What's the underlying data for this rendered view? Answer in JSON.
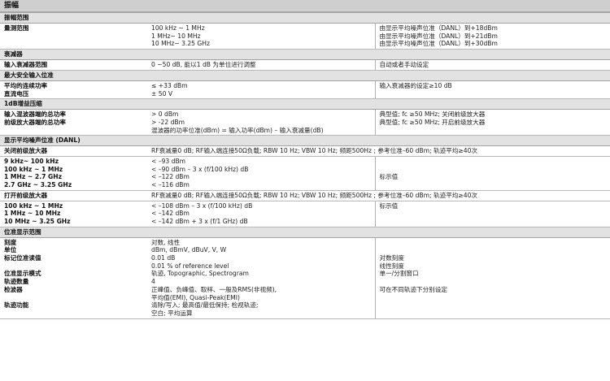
{
  "title": "振幅",
  "sections": {
    "s1": {
      "header": "振幅范围"
    },
    "s2": {
      "header": "衰减器"
    },
    "s3": {
      "header": "最大安全输入位准"
    },
    "s4": {
      "header": "1dB增益压缩"
    },
    "s5": {
      "header": "显示平均噪声位准 (DANL)"
    },
    "s6": {
      "header": "位准显示范围"
    }
  },
  "rows": {
    "r1": {
      "label": [
        "量测范围"
      ],
      "value": [
        "100 kHz ~ 1 MHz",
        "1 MHz~ 10 MHz",
        "10 MHz~ 3.25 GHz"
      ],
      "note": [
        "由显示平均噪声位准（DANL）到+18dBm",
        "由显示平均噪声位准（DANL）到+21dBm",
        "由显示平均噪声位准（DANL）到+30dBm"
      ]
    },
    "r2": {
      "label": [
        "输入衰减器范围"
      ],
      "value": [
        "0 ~50 dB, 能以1 dB 为单位进行调整"
      ],
      "note": [
        "自动或者手动设定"
      ]
    },
    "r3": {
      "label": [
        "平均的连续功率",
        "直流电压"
      ],
      "value": [
        "≤ +33 dBm",
        "± 50 V"
      ],
      "note": [
        "输入衰减器的设定≥10 dB"
      ]
    },
    "r4": {
      "label": [
        "输入混波器端的总功率",
        "前级放大器端的总功率"
      ],
      "value": [
        "> 0 dBm",
        "> -22 dBm",
        "混波器的功率位准(dBm) = 输入功率(dBm) – 输入衰减量(dB)"
      ],
      "note": [
        "典型值; fc ≥50 MHz; 关闭前级放大器",
        "典型值; fc ≥50 MHz; 开启前级放大器"
      ]
    },
    "r5": {
      "label": [
        "关闭前级放大器"
      ],
      "span": "RF衰减量0 dB; RF输入端连接50Ω负载; RBW 10 Hz; VBW 10 Hz; 频距500Hz ; 参考位准–60 dBm; 轨迹平均≥40次"
    },
    "r6": {
      "label": [
        "9 kHz~ 100 kHz",
        "100 kHz ~ 1 MHz",
        "1 MHz ~ 2.7 GHz",
        "2.7 GHz ~ 3.25 GHz"
      ],
      "value": [
        "< –93 dBm",
        "< –90 dBm – 3 x (f/100 kHz) dB",
        "< –122 dBm",
        "< –116 dBm"
      ],
      "note": [
        "",
        "",
        "标示值"
      ]
    },
    "r7": {
      "label": [
        "打开前级放大器"
      ],
      "span": "RF衰减量0 dB; RF输入端连接50Ω负载; RBW 10 Hz; VBW 10 Hz; 频距500Hz ; 参考位准–60 dBm; 轨迹平均≥40次"
    },
    "r8": {
      "label": [
        "100 kHz ~ 1 MHz",
        "1 MHz ~ 10 MHz",
        "10 MHz ~ 3.25 GHz"
      ],
      "value": [
        "< –108 dBm – 3 x (f/100 kHz) dB",
        "< –142 dBm",
        "< –142 dBm + 3 x (f/1 GHz) dB"
      ],
      "note": [
        "标示值"
      ]
    },
    "r9": {
      "label": [
        "刻度",
        "单位",
        "标记位准读值",
        "",
        "位准显示模式",
        "轨迹数量",
        "检波器",
        "",
        "轨迹功能",
        ""
      ],
      "value": [
        "对数, 线性",
        "dBm, dBmV, dBuV, V, W",
        "0.01 dB",
        "0.01 % of reference level",
        "轨迹, Topographic, Spectrogram",
        "4",
        "正峰值、负峰值、取样、一般及RMS(非视频),",
        "平均值(EMI), Quasi-Peak(EMI)",
        "清除/写入; 最高值/最低保持; 检视轨迹;",
        "空白; 平均运算"
      ],
      "note": [
        "",
        "",
        "对数刻度",
        "线性刻度",
        "单一/分割窗口",
        "",
        "可在不同轨迹下分别设定"
      ]
    }
  }
}
